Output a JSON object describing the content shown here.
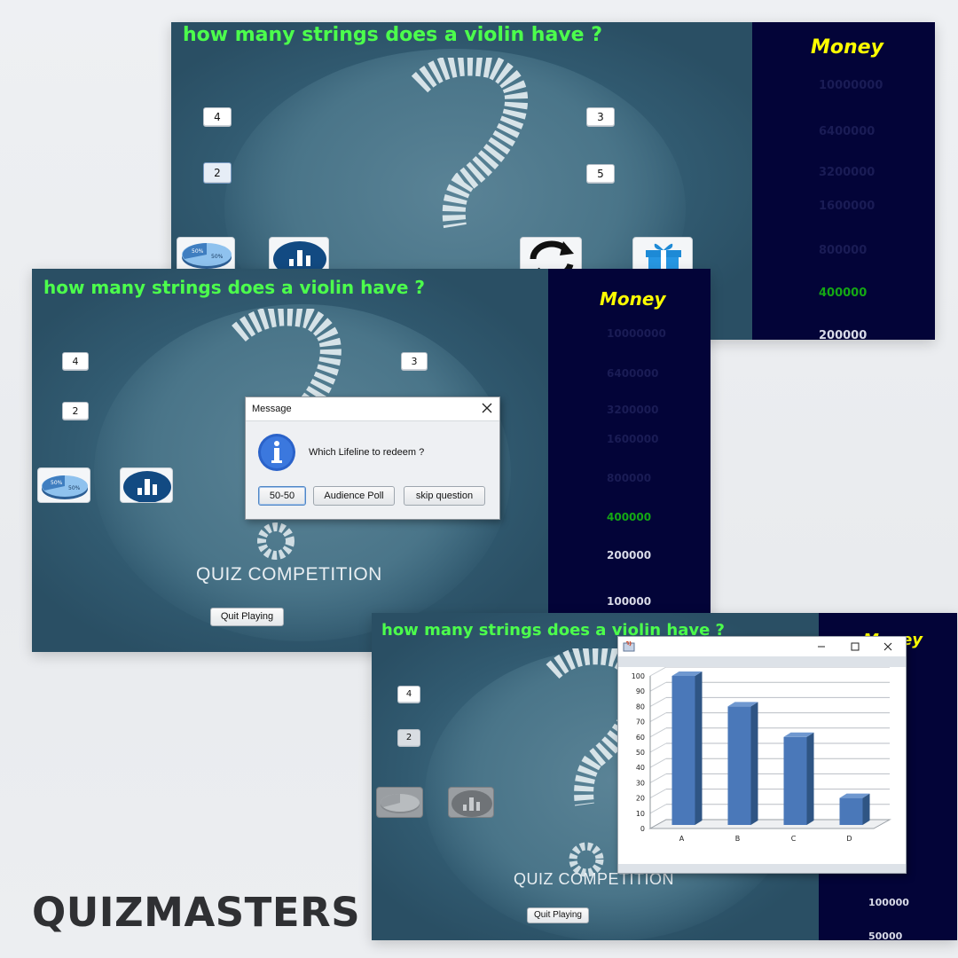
{
  "brand": "QUIZMASTERS",
  "question": "how many strings does a violin have ?",
  "options": {
    "a": "4",
    "b": "3",
    "c": "2",
    "d": "5"
  },
  "money_title": "Money",
  "money_ladder": [
    "10000000",
    "6400000",
    "3200000",
    "1600000",
    "800000",
    "400000",
    "200000",
    "100000",
    "50000"
  ],
  "competition_title": "QUIZ COMPETITION",
  "quit_label": "Quit Playing",
  "lifelines": {
    "fifty_fifty_pie_text": [
      "50%",
      "50%"
    ],
    "icons": [
      "fifty-fifty-icon",
      "audience-poll-icon",
      "skip-question-icon",
      "gift-icon"
    ]
  },
  "colors": {
    "question": "#4cff4c",
    "money_title": "#ffff00",
    "money_panel": "#030438",
    "current_level": "#14a814",
    "bar": "#4a78b9"
  },
  "dialog": {
    "title": "Message",
    "close_icon": "close-icon",
    "icon": "info-icon",
    "message": "Which Lifeline to redeem ?",
    "buttons": [
      "50-50",
      "Audience Poll",
      "skip question"
    ]
  },
  "chart_window": {
    "window_icon": "java-app-icon",
    "controls": [
      "minimize-icon",
      "maximize-icon",
      "close-icon"
    ]
  },
  "chart_data": {
    "type": "bar",
    "style": "3d",
    "categories": [
      "A",
      "B",
      "C",
      "D"
    ],
    "values": [
      100,
      80,
      60,
      20
    ],
    "ylim": [
      0,
      100
    ],
    "yticks": [
      0,
      10,
      20,
      30,
      40,
      50,
      60,
      70,
      80,
      90,
      100
    ],
    "grid": true,
    "title": "",
    "xlabel": "",
    "ylabel": ""
  }
}
